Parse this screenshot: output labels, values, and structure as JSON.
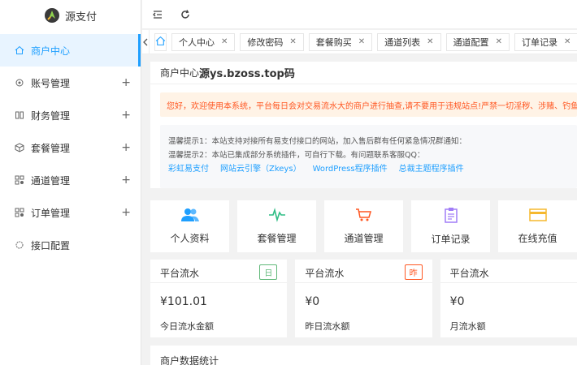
{
  "logo": {
    "text": "源支付"
  },
  "sidebar": {
    "items": [
      {
        "label": "商户中心",
        "icon": "home-icon",
        "active": true,
        "plus": ""
      },
      {
        "label": "账号管理",
        "icon": "gear-icon",
        "active": false,
        "plus": "+"
      },
      {
        "label": "财务管理",
        "icon": "finance-icon",
        "active": false,
        "plus": "+"
      },
      {
        "label": "套餐管理",
        "icon": "package-icon",
        "active": false,
        "plus": "+"
      },
      {
        "label": "通道管理",
        "icon": "channel-icon",
        "active": false,
        "plus": "+"
      },
      {
        "label": "订单管理",
        "icon": "order-icon",
        "active": false,
        "plus": "+"
      },
      {
        "label": "接口配置",
        "icon": "api-icon",
        "active": false,
        "plus": ""
      }
    ]
  },
  "tabs": [
    "个人中心",
    "修改密码",
    "套餐购买",
    "通道列表",
    "通道配置",
    "订单记录"
  ],
  "main": {
    "title_prefix": "商户中心",
    "title_strong": "源ys.bzoss.top码",
    "notice": "您好，欢迎使用本系统，平台每日会对交易流水大的商户进行抽查,请不要用于违规站点!严禁一切淫秽、涉赌、钓鱼、理财、借贷、代",
    "tip1": "温馨提示1：本站支持对接所有易支付接口的网站，加入售后群有任何紧急情况群通知：",
    "tip2": "温馨提示2：本站已集成部分系统插件，可自行下载。有问题联系客服QQ：",
    "links": [
      "彩虹易支付",
      "网站云引擎（Zkeys）",
      "WordPress程序插件",
      "总裁主题程序插件"
    ]
  },
  "quick": [
    {
      "label": "个人资料",
      "icon": "users-icon",
      "color": "#1e9fff"
    },
    {
      "label": "套餐管理",
      "icon": "pulse-icon",
      "color": "#2fbd85"
    },
    {
      "label": "通道管理",
      "icon": "cart-icon",
      "color": "#ff5722"
    },
    {
      "label": "订单记录",
      "icon": "clipboard-icon",
      "color": "#a17df7"
    },
    {
      "label": "在线充值",
      "icon": "card-icon",
      "color": "#f5b82e"
    }
  ],
  "stats": [
    {
      "title": "平台流水",
      "badge": "日",
      "badge_color": "#5fb878",
      "value": "¥101.01",
      "sub": "今日流水金额"
    },
    {
      "title": "平台流水",
      "badge": "昨",
      "badge_color": "#ff5722",
      "value": "¥0",
      "sub": "昨日流水额"
    },
    {
      "title": "平台流水",
      "badge": "",
      "badge_color": "#1e9fff",
      "value": "¥0",
      "sub": "月流水额"
    }
  ],
  "bottom": {
    "title": "商户数据统计"
  }
}
